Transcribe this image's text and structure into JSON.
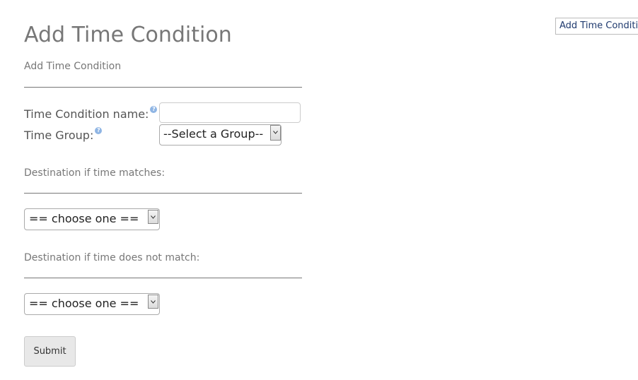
{
  "header": {
    "title": "Add Time Condition",
    "nav_link": "Add Time Condition"
  },
  "form": {
    "section_label": "Add Time Condition",
    "name_label": "Time Condition name:",
    "name_value": "",
    "group_label": "Time Group:",
    "group_selected": "--Select a Group--",
    "help_icon": "question-circle-icon",
    "match_section_label": "Destination if time matches:",
    "match_selected": "== choose one ==",
    "nomatch_section_label": "Destination if time does not match:",
    "nomatch_selected": "== choose one ==",
    "submit_label": "Submit"
  },
  "colors": {
    "title": "#777777",
    "help_icon": "#8fb5e4",
    "nav_link_text": "#1f3a6e"
  }
}
